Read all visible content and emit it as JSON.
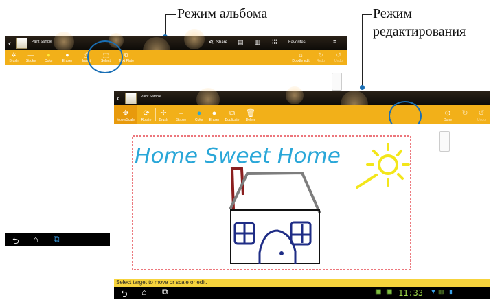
{
  "annotations": {
    "album_mode": "Режим альбома",
    "edit_mode_line1": "Режим",
    "edit_mode_line2": "редактирования"
  },
  "album_screen": {
    "title": "Paint Sample",
    "top_actions": [
      "Share",
      "Favorites"
    ],
    "toolbar": [
      "Brush",
      "Stroke",
      "Color",
      "Eraser",
      "Insert",
      "Select",
      "Text Plate"
    ],
    "toolbar_right": [
      "Doodle edit",
      "Redo",
      "Undo"
    ]
  },
  "edit_screen": {
    "title": "Paint Sample",
    "toolbar": [
      "Move/Scale",
      "Rotate",
      "Brush",
      "Stroke",
      "Color",
      "Eraser",
      "Duplicate",
      "Delete"
    ],
    "done_label": "Done",
    "undo_label": "Undo",
    "status_message": "Select target to move or scale or edit.",
    "clock": "11:33",
    "canvas_text": "Home Sweet Home"
  },
  "colors": {
    "toolbar_yellow": "#f2b019",
    "highlight_blue": "#1a6fb5",
    "status_bar_yellow": "#f6d33c",
    "drawing_cyan": "#2aa7d8",
    "sun_yellow": "#f3e61a",
    "chimney_red": "#8a1f1f",
    "roof_gray": "#7d7d7d",
    "window_blue": "#1f2d86"
  }
}
